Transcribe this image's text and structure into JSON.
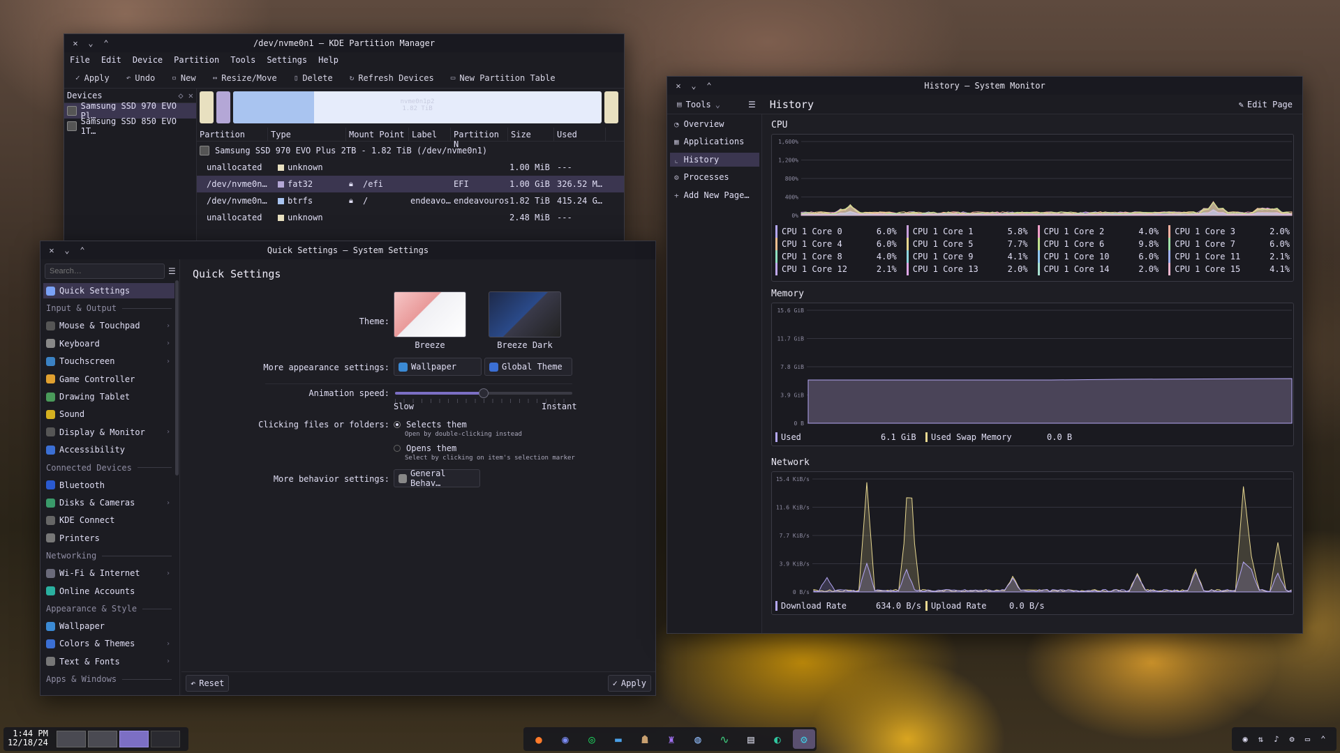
{
  "partition_manager": {
    "title": "/dev/nvme0n1 — KDE Partition Manager",
    "menu": [
      "File",
      "Edit",
      "Device",
      "Partition",
      "Tools",
      "Settings",
      "Help"
    ],
    "toolbar": {
      "apply": "Apply",
      "undo": "Undo",
      "new": "New",
      "resize": "Resize/Move",
      "delete": "Delete",
      "refresh": "Refresh Devices",
      "new_table": "New Partition Table"
    },
    "devices_title": "Devices",
    "devices": [
      "Samsung SSD 970 EVO Pl…",
      "Samsung SSD 850 EVO 1T…"
    ],
    "bar_label": "nvme0n1p2",
    "bar_size": "1.82 TiB",
    "columns": [
      "Partition",
      "Type",
      "Mount Point",
      "Label",
      "Partition N",
      "Size",
      "Used"
    ],
    "disk_row": "Samsung SSD 970 EVO Plus 2TB - 1.82 TiB (/dev/nvme0n1)",
    "rows": [
      {
        "partition": "unallocated",
        "type": "unknown",
        "mount": "",
        "label": "",
        "pname": "",
        "size": "1.00 MiB",
        "used": "---",
        "color": "#e8e0c0",
        "locked": false
      },
      {
        "partition": "/dev/nvme0n…",
        "type": "fat32",
        "mount": "/efi",
        "label": "",
        "pname": "EFI",
        "size": "1.00 GiB",
        "used": "326.52 M…",
        "color": "#b4a7d6",
        "locked": true
      },
      {
        "partition": "/dev/nvme0n…",
        "type": "btrfs",
        "mount": "/",
        "label": "endeavo…",
        "pname": "endeavouros",
        "size": "1.82 TiB",
        "used": "415.24 G…",
        "color": "#a9c4f0",
        "locked": true
      },
      {
        "partition": "unallocated",
        "type": "unknown",
        "mount": "",
        "label": "",
        "pname": "",
        "size": "2.48 MiB",
        "used": "---",
        "color": "#e8e0c0",
        "locked": false
      }
    ]
  },
  "settings": {
    "title": "Quick Settings — System Settings",
    "search_placeholder": "Search…",
    "page_title": "Quick Settings",
    "sidebar": [
      {
        "type": "item",
        "label": "Quick Settings",
        "color": "#7aa2f7",
        "selected": true
      },
      {
        "type": "section",
        "label": "Input & Output"
      },
      {
        "type": "item",
        "label": "Mouse & Touchpad",
        "color": "#555",
        "arrow": true
      },
      {
        "type": "item",
        "label": "Keyboard",
        "color": "#888",
        "arrow": true
      },
      {
        "type": "item",
        "label": "Touchscreen",
        "color": "#3b82c4",
        "arrow": true
      },
      {
        "type": "item",
        "label": "Game Controller",
        "color": "#e0a030"
      },
      {
        "type": "item",
        "label": "Drawing Tablet",
        "color": "#4a9a5a"
      },
      {
        "type": "item",
        "label": "Sound",
        "color": "#d4b020"
      },
      {
        "type": "item",
        "label": "Display & Monitor",
        "color": "#555",
        "arrow": true
      },
      {
        "type": "item",
        "label": "Accessibility",
        "color": "#3b6fd4"
      },
      {
        "type": "section",
        "label": "Connected Devices"
      },
      {
        "type": "item",
        "label": "Bluetooth",
        "color": "#2a5ad0"
      },
      {
        "type": "item",
        "label": "Disks & Cameras",
        "color": "#3a9a6a",
        "arrow": true
      },
      {
        "type": "item",
        "label": "KDE Connect",
        "color": "#666"
      },
      {
        "type": "item",
        "label": "Printers",
        "color": "#777"
      },
      {
        "type": "section",
        "label": "Networking"
      },
      {
        "type": "item",
        "label": "Wi-Fi & Internet",
        "color": "#6a6a7a",
        "arrow": true
      },
      {
        "type": "item",
        "label": "Online Accounts",
        "color": "#2ab0a0"
      },
      {
        "type": "section",
        "label": "Appearance & Style"
      },
      {
        "type": "item",
        "label": "Wallpaper",
        "color": "#3b8ad4"
      },
      {
        "type": "item",
        "label": "Colors & Themes",
        "color": "#3b6fd4",
        "arrow": true
      },
      {
        "type": "item",
        "label": "Text & Fonts",
        "color": "#777",
        "arrow": true
      },
      {
        "type": "section",
        "label": "Apps & Windows"
      }
    ],
    "theme_label": "Theme:",
    "themes": [
      "Breeze",
      "Breeze Dark"
    ],
    "appearance_label": "More appearance settings:",
    "wallpaper_btn": "Wallpaper",
    "global_theme_btn": "Global Theme",
    "anim_label": "Animation speed:",
    "slow": "Slow",
    "instant": "Instant",
    "anim_value": 0.5,
    "click_label": "Clicking files or folders:",
    "opt1": "Selects them",
    "opt1_hint": "Open by double-clicking instead",
    "opt2": "Opens them",
    "opt2_hint": "Select by clicking on item's selection marker",
    "behavior_label": "More behavior settings:",
    "behavior_btn": "General Behav…",
    "reset": "Reset",
    "apply": "Apply"
  },
  "monitor": {
    "title": "History — System Monitor",
    "tools": "Tools",
    "page_title": "History",
    "edit_page": "Edit Page",
    "nav": [
      "Overview",
      "Applications",
      "History",
      "Processes",
      "Add New Page…"
    ],
    "cpu_title": "CPU",
    "cpu_ticks": [
      "1,600%",
      "1,200%",
      "800%",
      "400%",
      "0%"
    ],
    "cores": [
      {
        "name": "CPU 1 Core 0",
        "val": "6.0%",
        "color": "#b4a7f5"
      },
      {
        "name": "CPU 1 Core 1",
        "val": "5.8%",
        "color": "#c9a0dc"
      },
      {
        "name": "CPU 1 Core 2",
        "val": "4.0%",
        "color": "#f0a0c8"
      },
      {
        "name": "CPU 1 Core 3",
        "val": "2.0%",
        "color": "#f5b0a0"
      },
      {
        "name": "CPU 1 Core 4",
        "val": "6.0%",
        "color": "#f0c090"
      },
      {
        "name": "CPU 1 Core 5",
        "val": "7.7%",
        "color": "#e8d890"
      },
      {
        "name": "CPU 1 Core 6",
        "val": "9.8%",
        "color": "#c0e090"
      },
      {
        "name": "CPU 1 Core 7",
        "val": "6.0%",
        "color": "#a0e0a8"
      },
      {
        "name": "CPU 1 Core 8",
        "val": "4.0%",
        "color": "#90e0c0"
      },
      {
        "name": "CPU 1 Core 9",
        "val": "4.1%",
        "color": "#90d8e0"
      },
      {
        "name": "CPU 1 Core 10",
        "val": "6.0%",
        "color": "#90c8f0"
      },
      {
        "name": "CPU 1 Core 11",
        "val": "2.1%",
        "color": "#a0b0f0"
      },
      {
        "name": "CPU 1 Core 12",
        "val": "2.1%",
        "color": "#c0a8f0"
      },
      {
        "name": "CPU 1 Core 13",
        "val": "2.0%",
        "color": "#e0a8e8"
      },
      {
        "name": "CPU 1 Core 14",
        "val": "2.0%",
        "color": "#a8e0d0"
      },
      {
        "name": "CPU 1 Core 15",
        "val": "4.1%",
        "color": "#f0b8d0"
      }
    ],
    "mem_title": "Memory",
    "mem_ticks": [
      "15.6 GiB",
      "11.7 GiB",
      "7.8 GiB",
      "3.9 GiB",
      "0 B"
    ],
    "mem_used_label": "Used",
    "mem_used": "6.1 GiB",
    "swap_label": "Used Swap Memory",
    "swap": "0.0 B",
    "net_title": "Network",
    "net_ticks": [
      "15.4 KiB/s",
      "11.6 KiB/s",
      "7.7 KiB/s",
      "3.9 KiB/s",
      "0 B/s"
    ],
    "down_label": "Download Rate",
    "down": "634.0 B/s",
    "up_label": "Upload Rate",
    "up": "0.0 B/s"
  },
  "taskbar": {
    "time": "1:44 PM",
    "date": "12/18/24",
    "apps": [
      "firefox-icon",
      "discord-icon",
      "spotify-icon",
      "dolphin-icon",
      "game-icon",
      "krita-icon",
      "steam-icon",
      "monitor-icon",
      "kate-icon",
      "partition-icon",
      "settings-icon"
    ]
  }
}
